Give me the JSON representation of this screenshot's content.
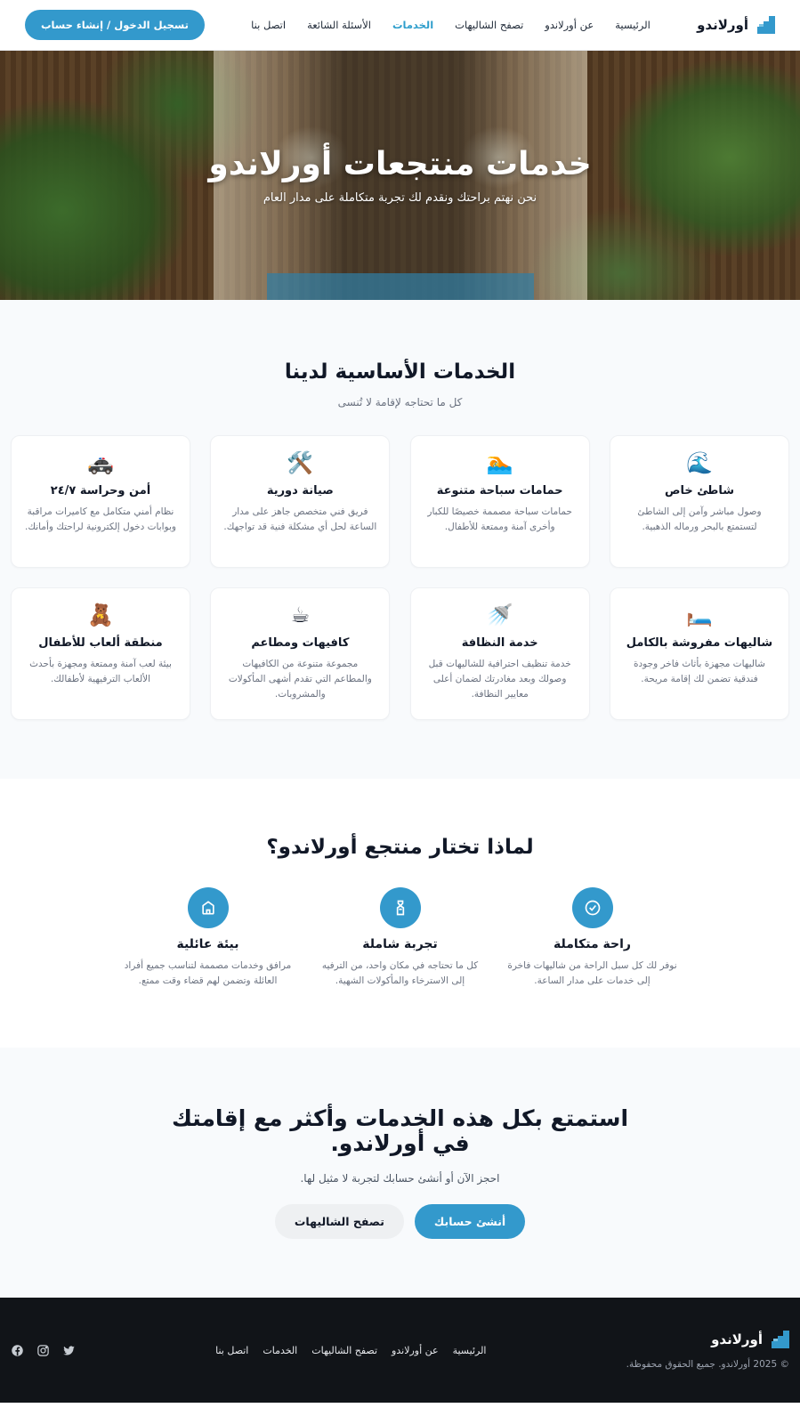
{
  "nav": {
    "brand": "أورلاندو",
    "links": [
      "الرئيسية",
      "عن أورلاندو",
      "تصفح الشاليهات",
      "الخدمات",
      "الأسئلة الشائعة",
      "اتصل بنا"
    ],
    "active": "الخدمات",
    "login_label": "تسجيل الدخول / إنشاء حساب"
  },
  "hero": {
    "title": "خدمات منتجعات أورلاندو",
    "subtitle": "نحن نهتم براحتك ونقدم لك تجربة متكاملة على مدار العام"
  },
  "services": {
    "title": "الخدمات الأساسية لدينا",
    "subtitle": "كل ما تحتاجه لإقامة لا تُنسى",
    "items": [
      {
        "icon": "🌊",
        "title": "شاطئ خاص",
        "desc": "وصول مباشر وآمن إلى الشاطئ لتستمتع بالبحر ورماله الذهبية."
      },
      {
        "icon": "🏊",
        "title": "حمامات سباحة متنوعة",
        "desc": "حمامات سباحة مصممة خصيصًا للكبار وأخرى آمنة وممتعة للأطفال."
      },
      {
        "icon": "🛠️",
        "title": "صيانة دورية",
        "desc": "فريق فني متخصص جاهز على مدار الساعة لحل أي مشكلة فنية قد تواجهك."
      },
      {
        "icon": "🚓",
        "title": "أمن وحراسة ٢٤/٧",
        "desc": "نظام أمني متكامل مع كاميرات مراقبة وبوابات دخول إلكترونية لراحتك وأمانك."
      },
      {
        "icon": "🛏️",
        "title": "شاليهات مفروشة بالكامل",
        "desc": "شاليهات مجهزة بأثاث فاخر وجودة فندقية تضمن لك إقامة مريحة."
      },
      {
        "icon": "🚿",
        "title": "خدمة النظافة",
        "desc": "خدمة تنظيف احترافية للشاليهات قبل وصولك وبعد مغادرتك لضمان أعلى معايير النظافة."
      },
      {
        "icon": "☕",
        "title": "كافيهات ومطاعم",
        "desc": "مجموعة متنوعة من الكافيهات والمطاعم التي تقدم أشهى المأكولات والمشروبات."
      },
      {
        "icon": "🧸",
        "title": "منطقة ألعاب للأطفال",
        "desc": "بيئة لعب آمنة وممتعة ومجهزة بأحدث الألعاب الترفيهية لأطفالك."
      }
    ]
  },
  "why": {
    "title": "لماذا تختار منتجع أورلاندو؟",
    "items": [
      {
        "icon": "check-circle-icon",
        "title": "راحة متكاملة",
        "desc": "نوفر لك كل سبل الراحة من شاليهات فاخرة إلى خدمات على مدار الساعة."
      },
      {
        "icon": "bottle-icon",
        "title": "تجربة شاملة",
        "desc": "كل ما تحتاجه في مكان واحد، من الترفيه إلى الاسترخاء والمأكولات الشهية."
      },
      {
        "icon": "home-icon",
        "title": "بيئة عائلية",
        "desc": "مرافق وخدمات مصممة لتناسب جميع أفراد العائلة وتضمن لهم قضاء وقت ممتع."
      }
    ]
  },
  "cta": {
    "title": "استمتع بكل هذه الخدمات وأكثر مع إقامتك في أورلاندو.",
    "subtitle": "احجز الآن أو أنشئ حسابك لتجربة لا مثيل لها.",
    "primary": "أنشئ حسابك",
    "secondary": "تصفح الشاليهات"
  },
  "footer": {
    "brand": "أورلاندو",
    "copyright": "© 2025 أورلاندو. جميع الحقوق محفوظة.",
    "links": [
      "الرئيسية",
      "عن أورلاندو",
      "تصفح الشاليهات",
      "الخدمات",
      "اتصل بنا"
    ],
    "socials": [
      "twitter-icon",
      "instagram-icon",
      "facebook-icon"
    ]
  },
  "colors": {
    "accent": "#3399cc",
    "footer_bg": "#111418",
    "section_bg": "#f8fafc"
  }
}
